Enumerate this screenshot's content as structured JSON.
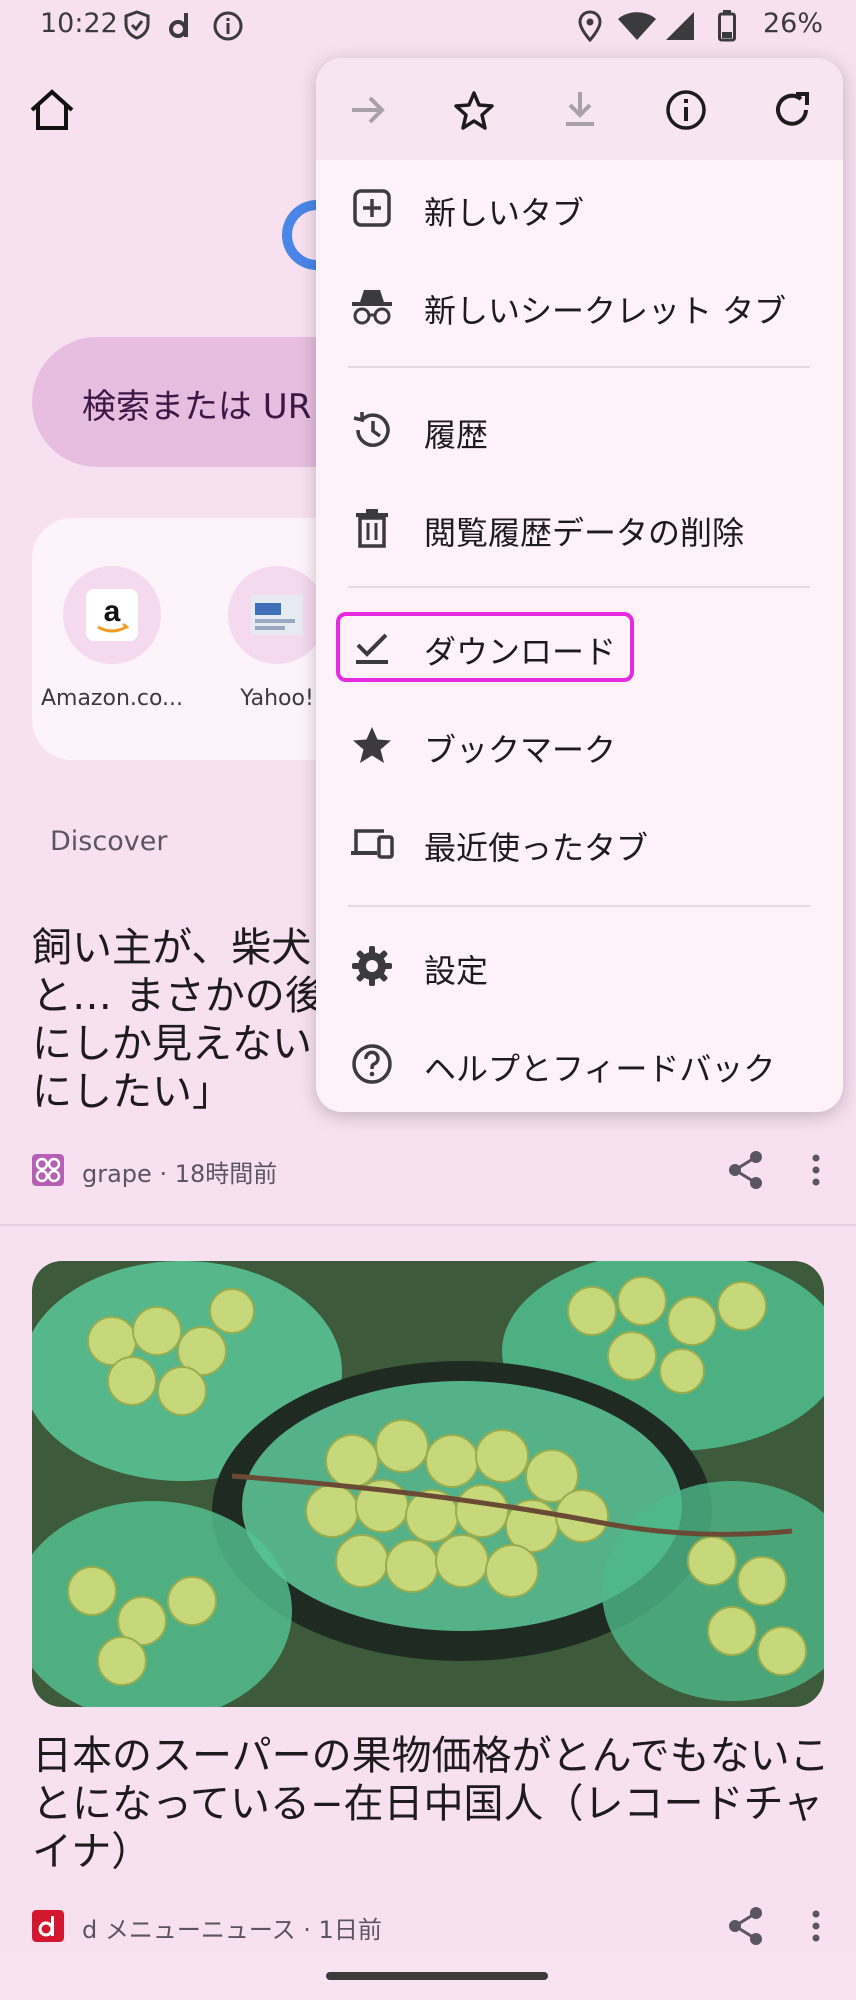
{
  "status_bar": {
    "time": "10:22",
    "battery": "26%",
    "icons": [
      "shield-icon",
      "docomo-d-icon",
      "info-icon",
      "location-icon",
      "wifi-icon",
      "signal-icon",
      "battery-icon"
    ]
  },
  "search": {
    "placeholder": "検索または UR"
  },
  "shortcuts": [
    {
      "label": "Amazon.co...",
      "icon": "amazon-logo"
    },
    {
      "label": "Yahoo!",
      "icon": "yahoo-logo"
    }
  ],
  "discover": {
    "label": "Discover"
  },
  "articles": [
    {
      "title": "飼い主が、柴犬\nと… まさかの後\nにしか見えない\nにしたい」",
      "source": "grape · 18時間前"
    },
    {
      "title": "日本のスーパーの果物価格がとんでもないことになっている−在日中国人（レコードチャイナ）",
      "source": "d メニューニュース · 1日前"
    }
  ],
  "menu": {
    "toolbar_icons": [
      "forward-arrow-icon",
      "star-outline-icon",
      "download-icon",
      "info-icon",
      "refresh-icon"
    ],
    "items": [
      {
        "label": "新しいタブ",
        "icon": "plus-box-icon"
      },
      {
        "label": "新しいシークレット タブ",
        "icon": "incognito-icon"
      },
      {
        "label": "履歴",
        "icon": "history-icon"
      },
      {
        "label": "閲覧履歴データの削除",
        "icon": "trash-icon"
      },
      {
        "label": "ダウンロード",
        "icon": "download-done-icon"
      },
      {
        "label": "ブックマーク",
        "icon": "star-icon"
      },
      {
        "label": "最近使ったタブ",
        "icon": "devices-icon"
      },
      {
        "label": "設定",
        "icon": "gear-icon"
      },
      {
        "label": "ヘルプとフィードバック",
        "icon": "help-icon"
      }
    ],
    "highlighted_item": "ダウンロード",
    "highlight_color": "#e52adf"
  },
  "colors": {
    "background": "#f7e1f1",
    "search_bar": "#e7bde0",
    "menu_bg": "#fdf2f8"
  }
}
